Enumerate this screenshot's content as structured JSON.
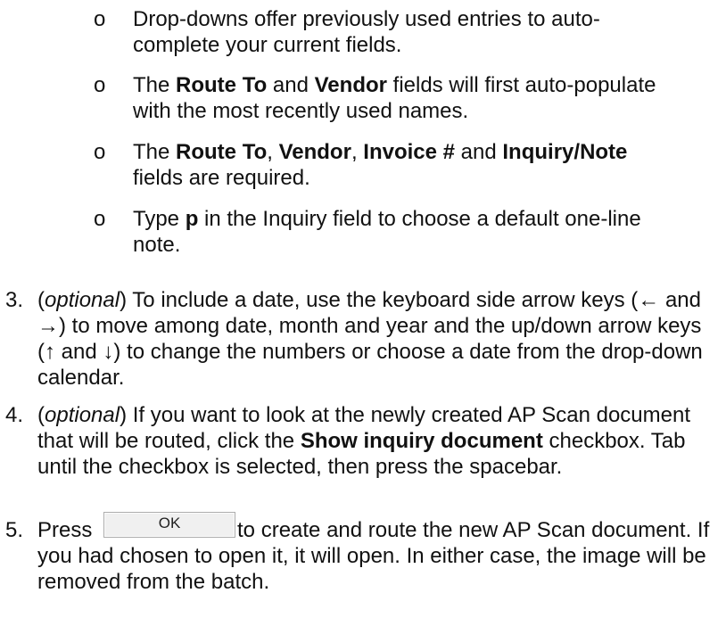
{
  "bullets": {
    "marker": "o",
    "items": [
      {
        "text": "Drop-downs offer previously used entries to auto-complete your current fields."
      },
      {
        "pre": "The ",
        "b1": "Route To",
        "mid1": " and ",
        "b2": "Vendor",
        "post": " fields will first auto-populate with the most recently used names."
      },
      {
        "pre": "The ",
        "b1": "Route To",
        "mid1": ", ",
        "b2": "Vendor",
        "mid2": ", ",
        "b3": "Invoice #",
        "mid3": " and ",
        "b4": "Inquiry/Note",
        "post": " fields are required."
      },
      {
        "pre": "Type ",
        "b1": "p",
        "post": " in the Inquiry field to choose a default one-line note."
      }
    ]
  },
  "steps": [
    {
      "number": "3.",
      "open": "(",
      "italic": "optional",
      "text": ") To include a date, use the keyboard side arrow keys (← and →) to move among date, month and year and the up/down arrow keys (↑ and ↓) to change the numbers or choose a date from the drop-down calendar."
    },
    {
      "number": "4.",
      "open": "(",
      "italic": "optional",
      "pre": ") If you want to look at the newly created AP Scan document that will be routed, click the ",
      "bold": "Show inquiry document",
      "post": " checkbox.  Tab until the checkbox is selected, then press the spacebar."
    },
    {
      "number": "5.",
      "pre": "Press ",
      "button_label": "OK",
      "post": "to create and route the new AP Scan document.  If you had chosen to open it, it will open.  In either case, the image will be removed from the batch."
    }
  ]
}
